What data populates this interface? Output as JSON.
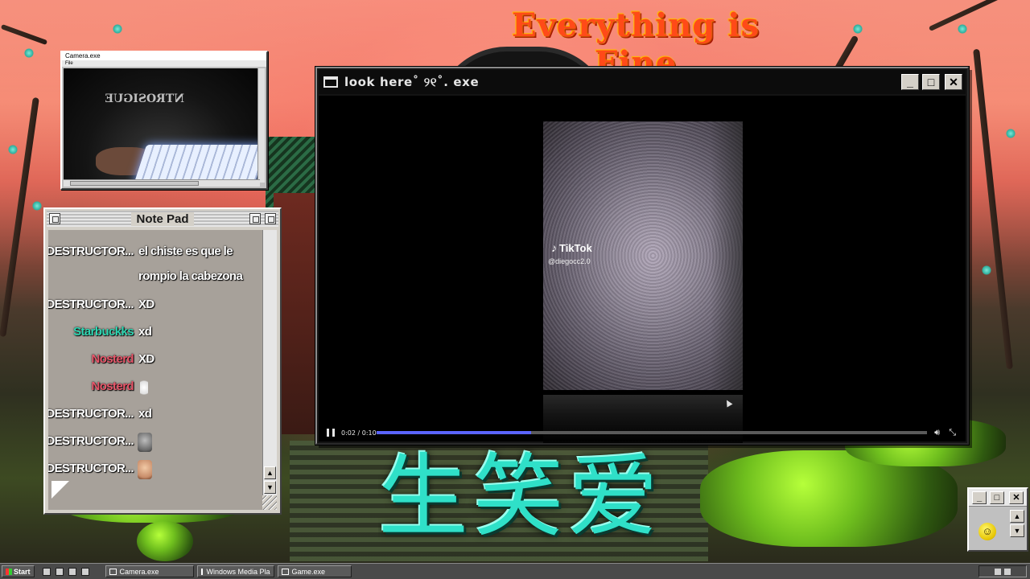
{
  "desktop": {
    "banner": "Everything is Fine",
    "chinese_text": "生笑爱"
  },
  "camera_window": {
    "title": "Camera.exe",
    "menu": "File",
    "shirt_text": "NTROSIGUE"
  },
  "notepad": {
    "title": "Note Pad",
    "messages": [
      {
        "user": "DESTRUCTOR...",
        "user_color": "#ffffff",
        "text": "el chiste es que le rompio la cabezona",
        "emote": ""
      },
      {
        "user": "DESTRUCTOR...",
        "user_color": "#ffffff",
        "text": "XD",
        "emote": ""
      },
      {
        "user": "Starbuckks",
        "user_color": "#2fd6b2",
        "text": "xd",
        "emote": ""
      },
      {
        "user": "Nosterd",
        "user_color": "#e8566a",
        "text": "XD",
        "emote": ""
      },
      {
        "user": "Nosterd",
        "user_color": "#e8566a",
        "text": "",
        "emote": "hand"
      },
      {
        "user": "DESTRUCTOR...",
        "user_color": "#ffffff",
        "text": "xd",
        "emote": ""
      },
      {
        "user": "DESTRUCTOR...",
        "user_color": "#ffffff",
        "text": "",
        "emote": "gray"
      },
      {
        "user": "DESTRUCTOR...",
        "user_color": "#ffffff",
        "text": "",
        "emote": "face"
      }
    ]
  },
  "video_window": {
    "title": "look here˚ ୨୧˚. exe",
    "tiktok_label": "TikTok",
    "tiktok_handle": "@diegocc2.0",
    "timecode": "0:02 / 0:10",
    "progress": 0.28
  },
  "taskbar": {
    "start_label": "Start",
    "tasks": [
      "Camera.exe",
      "Windows Media Pla",
      "Game.exe"
    ]
  }
}
